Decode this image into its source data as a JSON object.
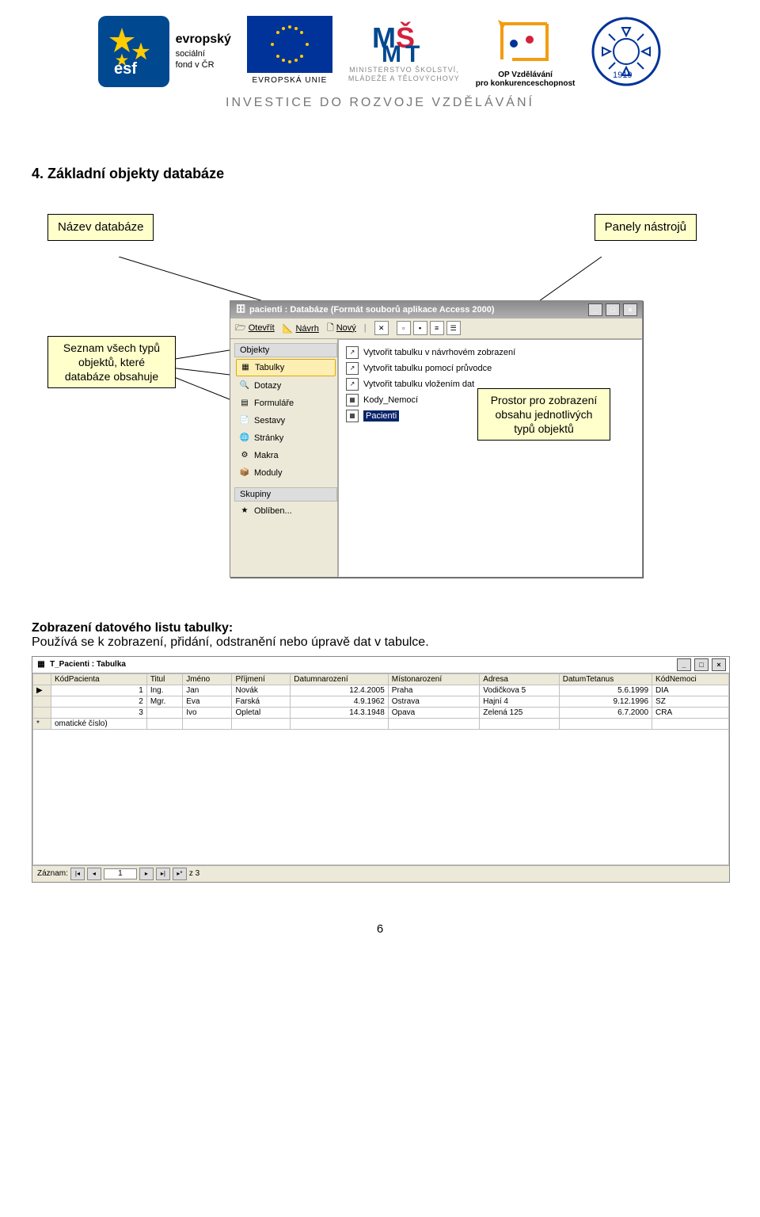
{
  "header": {
    "esf_line1": "evropský",
    "esf_line2": "sociální",
    "esf_line3": "fond v ČR",
    "eu_caption": "EVROPSKÁ UNIE",
    "msmt_line1": "MINISTERSTVO ŠKOLSTVÍ,",
    "msmt_line2": "MLÁDEŽE A TĚLOVÝCHOVY",
    "opvk_line1": "OP Vzdělávání",
    "opvk_line2": "pro konkurenceschopnost",
    "cog_year": "1919",
    "tagline": "INVESTICE DO ROZVOJE VZDĚLÁVÁNÍ"
  },
  "section_title": "4. Základní objekty databáze",
  "callouts": {
    "db_name": "Název databáze",
    "toolbars": "Panely nástrojů",
    "types_list": "Seznam všech typů objektů, které databáze obsahuje",
    "content_area": "Prostor pro zobrazení obsahu jednotlivých typů objektů"
  },
  "db_window": {
    "title": "pacienti : Databáze (Formát souborů aplikace Access 2000)",
    "toolbar": {
      "open": "Otevřít",
      "design": "Návrh",
      "new": "Nový"
    },
    "sidebar_header": "Objekty",
    "sidebar_items": [
      "Tabulky",
      "Dotazy",
      "Formuláře",
      "Sestavy",
      "Stránky",
      "Makra",
      "Moduly"
    ],
    "sidebar_groups": "Skupiny",
    "sidebar_fav": "Oblíben...",
    "main_items": [
      "Vytvořit tabulku v návrhovém zobrazení",
      "Vytvořit tabulku pomocí průvodce",
      "Vytvořit tabulku vložením dat",
      "Kody_Nemocí",
      "Pacienti"
    ]
  },
  "subsection": {
    "heading": "Zobrazení datového listu tabulky:",
    "body": "Používá se k zobrazení, přidání, odstranění nebo úpravě dat v tabulce."
  },
  "table_window": {
    "title": "T_Pacienti : Tabulka",
    "columns": [
      "KódPacienta",
      "Titul",
      "Jméno",
      "Příjmení",
      "Datumnarození",
      "Místonarození",
      "Adresa",
      "DatumTetanus",
      "KódNemoci"
    ],
    "rows": [
      [
        "1",
        "Ing.",
        "Jan",
        "Novák",
        "12.4.2005",
        "Praha",
        "Vodičkova 5",
        "5.6.1999",
        "DIA"
      ],
      [
        "2",
        "Mgr.",
        "Eva",
        "Farská",
        "4.9.1962",
        "Ostrava",
        "Hajní 4",
        "9.12.1996",
        "SZ"
      ],
      [
        "3",
        "",
        "Ivo",
        "Opletal",
        "14.3.1948",
        "Opava",
        "Zelená 125",
        "6.7.2000",
        "CRA"
      ]
    ],
    "new_row_placeholder": "omatické číslo)",
    "nav": {
      "label": "Záznam:",
      "current": "1",
      "total": "z 3"
    }
  },
  "page_number": "6"
}
